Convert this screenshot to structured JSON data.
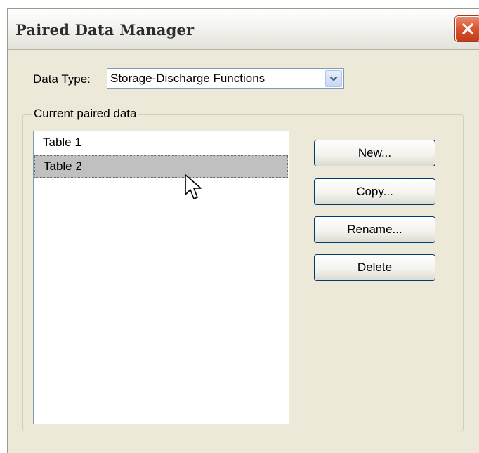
{
  "window": {
    "title": "Paired Data Manager",
    "close_icon": "close-icon"
  },
  "data_type": {
    "label": "Data Type:",
    "selected": "Storage-Discharge Functions",
    "dropdown_icon": "chevron-down-icon"
  },
  "group": {
    "label": "Current paired data"
  },
  "list": {
    "items": [
      {
        "label": "Table 1",
        "selected": false
      },
      {
        "label": "Table 2",
        "selected": true
      }
    ]
  },
  "buttons": {
    "new": "New...",
    "copy": "Copy...",
    "rename": "Rename...",
    "delete": "Delete"
  },
  "colors": {
    "window_bg": "#ece9d8",
    "selection_bg": "#c0c0c0",
    "close_button": "#d8542e",
    "button_border": "#003c74"
  }
}
